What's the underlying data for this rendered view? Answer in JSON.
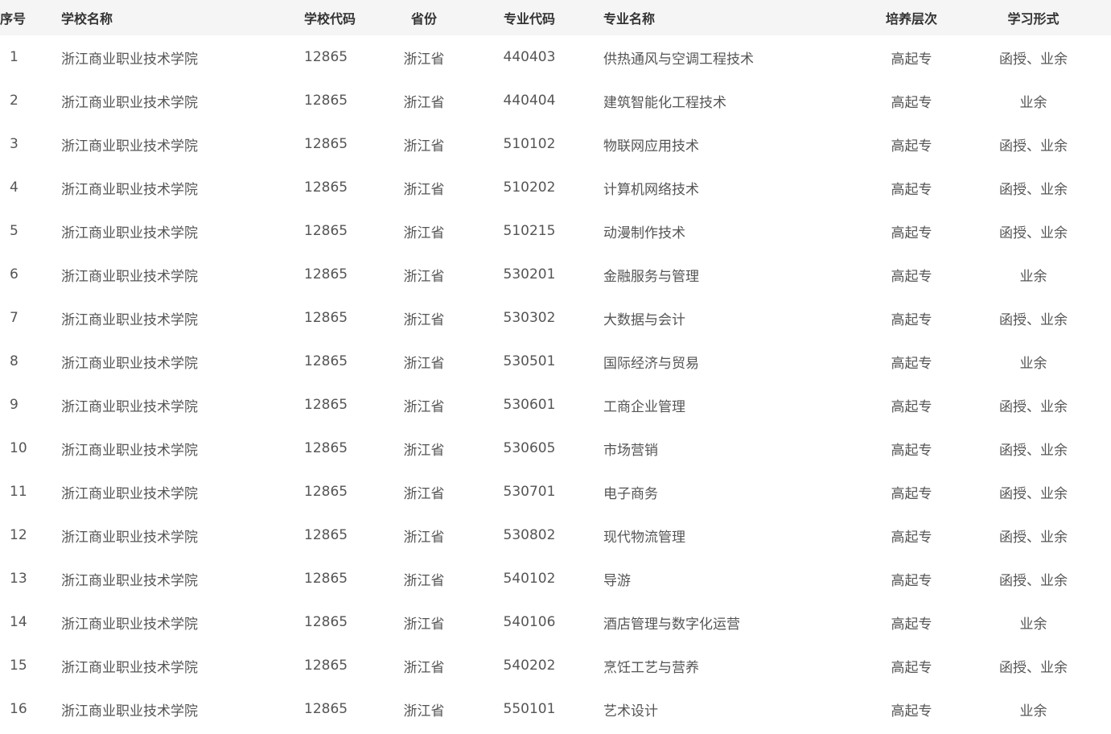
{
  "table": {
    "headers": {
      "index": "序号",
      "school_name": "学校名称",
      "school_code": "学校代码",
      "province": "省份",
      "major_code": "专业代码",
      "major_name": "专业名称",
      "level": "培养层次",
      "study_mode": "学习形式"
    },
    "rows": [
      {
        "index": "1",
        "school_name": "浙江商业职业技术学院",
        "school_code": "12865",
        "province": "浙江省",
        "major_code": "440403",
        "major_name": "供热通风与空调工程技术",
        "level": "高起专",
        "study_mode": "函授、业余"
      },
      {
        "index": "2",
        "school_name": "浙江商业职业技术学院",
        "school_code": "12865",
        "province": "浙江省",
        "major_code": "440404",
        "major_name": "建筑智能化工程技术",
        "level": "高起专",
        "study_mode": "业余"
      },
      {
        "index": "3",
        "school_name": "浙江商业职业技术学院",
        "school_code": "12865",
        "province": "浙江省",
        "major_code": "510102",
        "major_name": "物联网应用技术",
        "level": "高起专",
        "study_mode": "函授、业余"
      },
      {
        "index": "4",
        "school_name": "浙江商业职业技术学院",
        "school_code": "12865",
        "province": "浙江省",
        "major_code": "510202",
        "major_name": "计算机网络技术",
        "level": "高起专",
        "study_mode": "函授、业余"
      },
      {
        "index": "5",
        "school_name": "浙江商业职业技术学院",
        "school_code": "12865",
        "province": "浙江省",
        "major_code": "510215",
        "major_name": "动漫制作技术",
        "level": "高起专",
        "study_mode": "函授、业余"
      },
      {
        "index": "6",
        "school_name": "浙江商业职业技术学院",
        "school_code": "12865",
        "province": "浙江省",
        "major_code": "530201",
        "major_name": "金融服务与管理",
        "level": "高起专",
        "study_mode": "业余"
      },
      {
        "index": "7",
        "school_name": "浙江商业职业技术学院",
        "school_code": "12865",
        "province": "浙江省",
        "major_code": "530302",
        "major_name": "大数据与会计",
        "level": "高起专",
        "study_mode": "函授、业余"
      },
      {
        "index": "8",
        "school_name": "浙江商业职业技术学院",
        "school_code": "12865",
        "province": "浙江省",
        "major_code": "530501",
        "major_name": "国际经济与贸易",
        "level": "高起专",
        "study_mode": "业余"
      },
      {
        "index": "9",
        "school_name": "浙江商业职业技术学院",
        "school_code": "12865",
        "province": "浙江省",
        "major_code": "530601",
        "major_name": "工商企业管理",
        "level": "高起专",
        "study_mode": "函授、业余"
      },
      {
        "index": "10",
        "school_name": "浙江商业职业技术学院",
        "school_code": "12865",
        "province": "浙江省",
        "major_code": "530605",
        "major_name": "市场营销",
        "level": "高起专",
        "study_mode": "函授、业余"
      },
      {
        "index": "11",
        "school_name": "浙江商业职业技术学院",
        "school_code": "12865",
        "province": "浙江省",
        "major_code": "530701",
        "major_name": "电子商务",
        "level": "高起专",
        "study_mode": "函授、业余"
      },
      {
        "index": "12",
        "school_name": "浙江商业职业技术学院",
        "school_code": "12865",
        "province": "浙江省",
        "major_code": "530802",
        "major_name": "现代物流管理",
        "level": "高起专",
        "study_mode": "函授、业余"
      },
      {
        "index": "13",
        "school_name": "浙江商业职业技术学院",
        "school_code": "12865",
        "province": "浙江省",
        "major_code": "540102",
        "major_name": "导游",
        "level": "高起专",
        "study_mode": "函授、业余"
      },
      {
        "index": "14",
        "school_name": "浙江商业职业技术学院",
        "school_code": "12865",
        "province": "浙江省",
        "major_code": "540106",
        "major_name": "酒店管理与数字化运营",
        "level": "高起专",
        "study_mode": "业余"
      },
      {
        "index": "15",
        "school_name": "浙江商业职业技术学院",
        "school_code": "12865",
        "province": "浙江省",
        "major_code": "540202",
        "major_name": "烹饪工艺与营养",
        "level": "高起专",
        "study_mode": "函授、业余"
      },
      {
        "index": "16",
        "school_name": "浙江商业职业技术学院",
        "school_code": "12865",
        "province": "浙江省",
        "major_code": "550101",
        "major_name": "艺术设计",
        "level": "高起专",
        "study_mode": "业余"
      }
    ]
  }
}
